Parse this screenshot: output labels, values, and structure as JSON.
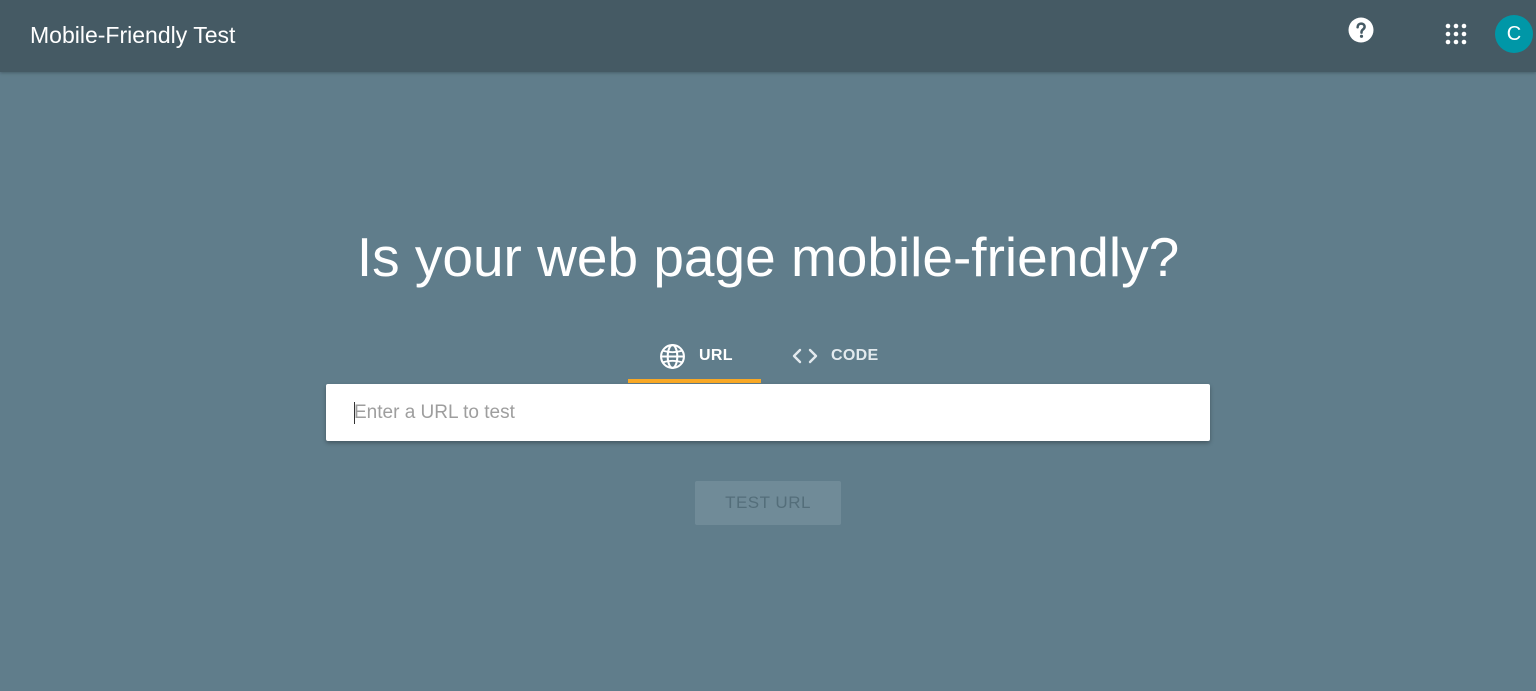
{
  "header": {
    "app_title": "Mobile-Friendly Test",
    "help_icon": "help-circle-icon",
    "apps_icon": "apps-grid-icon",
    "avatar_initial": "C",
    "avatar_color": "#0097a7"
  },
  "main": {
    "headline": "Is your web page mobile-friendly?",
    "tabs": [
      {
        "label": "URL",
        "icon": "globe-icon",
        "selected": true
      },
      {
        "label": "CODE",
        "icon": "code-brackets-icon",
        "selected": false
      }
    ],
    "url_input": {
      "value": "",
      "placeholder": "Enter a URL to test"
    },
    "test_button_label": "TEST URL"
  },
  "colors": {
    "page_background": "#607d8b",
    "header_background": "#455a64",
    "tab_indicator": "#f9a825"
  }
}
